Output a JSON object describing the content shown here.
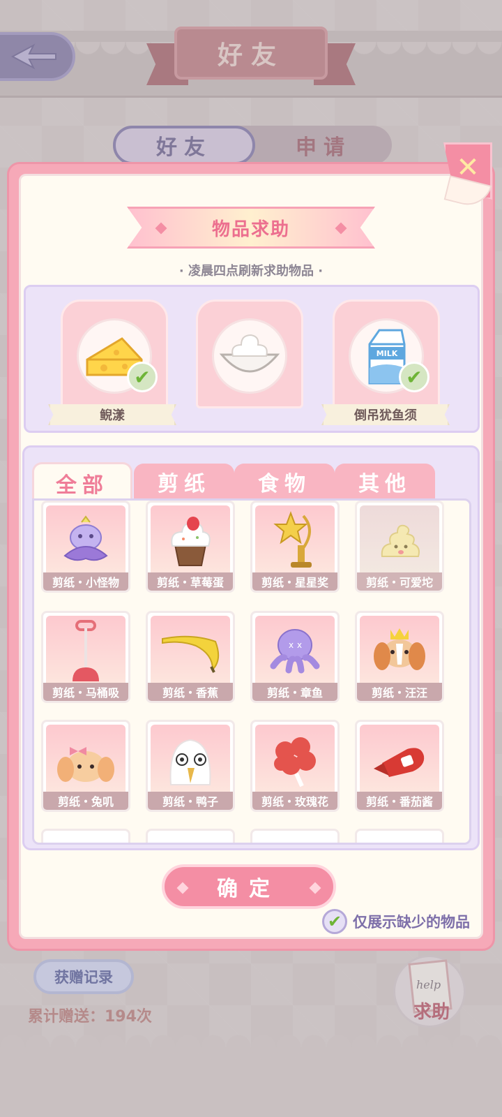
{
  "header": {
    "title": "好友",
    "back_icon": "back-arrow-icon"
  },
  "friend_tabs": [
    {
      "label": "好友",
      "active": true
    },
    {
      "label": "申请",
      "active": false
    }
  ],
  "modal": {
    "title": "物品求助",
    "subtitle": "· 凌晨四点刷新求助物品 ·",
    "slots": [
      {
        "label": "鲵漾",
        "icon": "cheese-icon",
        "checked": true
      },
      {
        "label": "",
        "icon": "cream-bowl-icon",
        "checked": false
      },
      {
        "label": "倒吊犹鱼须",
        "icon": "milk-carton-icon",
        "checked": true
      }
    ],
    "category_tabs": [
      "全部",
      "剪纸",
      "食物",
      "其他"
    ],
    "items": [
      {
        "name": "剪纸・小怪物",
        "icon": "little-monster-icon"
      },
      {
        "name": "剪纸・草莓蛋",
        "icon": "strawberry-cupcake-icon"
      },
      {
        "name": "剪纸・星星奖",
        "icon": "star-trophy-icon"
      },
      {
        "name": "剪纸・可爱坨",
        "icon": "cute-swirl-icon"
      },
      {
        "name": "剪纸・马桶吸",
        "icon": "plunger-icon"
      },
      {
        "name": "剪纸・香蕉",
        "icon": "banana-icon"
      },
      {
        "name": "剪纸・章鱼",
        "icon": "octopus-icon"
      },
      {
        "name": "剪纸・汪汪",
        "icon": "puppy-icon"
      },
      {
        "name": "剪纸・兔叽",
        "icon": "bunny-icon"
      },
      {
        "name": "剪纸・鸭子",
        "icon": "duck-icon"
      },
      {
        "name": "剪纸・玫瑰花",
        "icon": "rose-icon"
      },
      {
        "name": "剪纸・番茄酱",
        "icon": "ketchup-icon"
      }
    ],
    "confirm_label": "确定",
    "filter_label": "仅展示缺少的物品",
    "filter_checked": true,
    "close_icon": "close-x-icon"
  },
  "footer": {
    "gift_record_label": "获赠记录",
    "gift_total": "累计赠送：194次",
    "help_label": "求助",
    "help_note_text": "help"
  },
  "colors": {
    "accent_pink": "#f48ea4",
    "panel_lavender": "#ece3f8",
    "check_green": "#6eb437"
  }
}
